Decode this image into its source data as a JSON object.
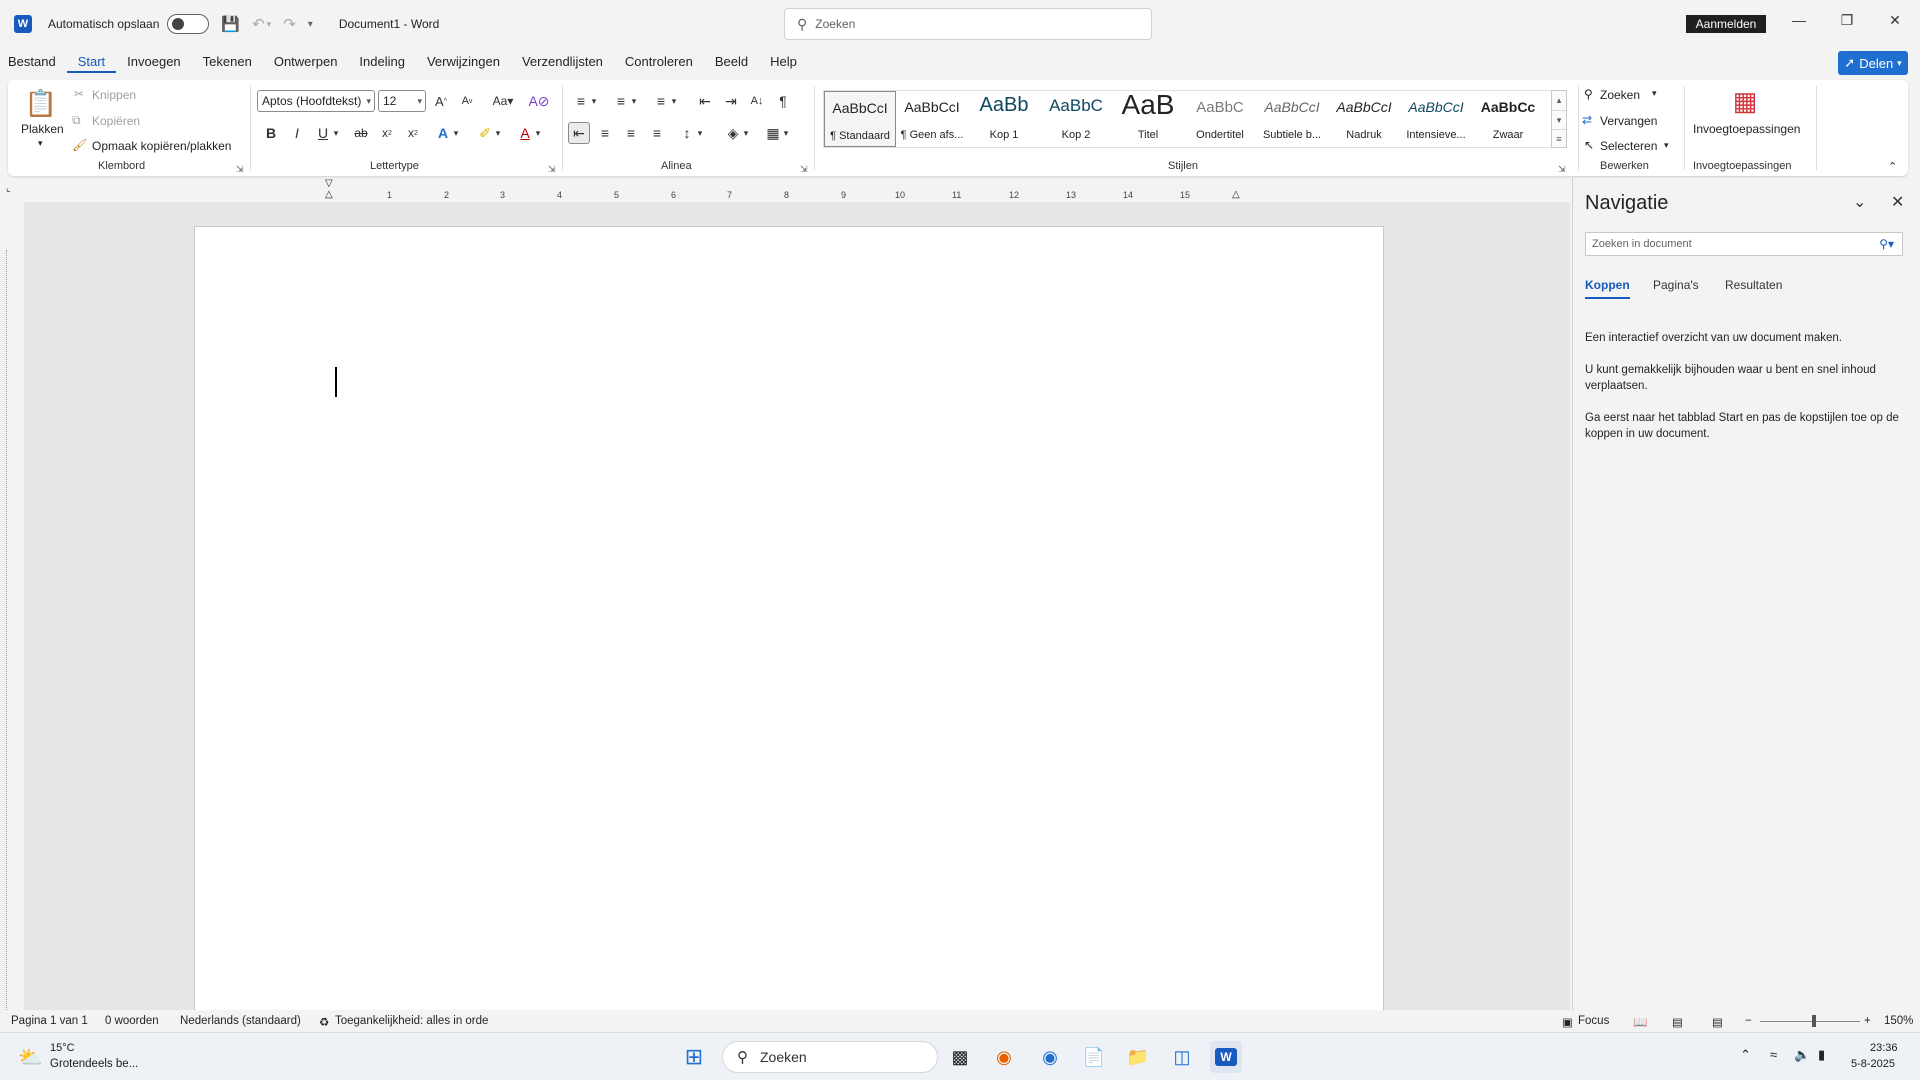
{
  "titlebar": {
    "autosave_label": "Automatisch opslaan",
    "doc_title": "Document1  -  Word",
    "search_placeholder": "Zoeken",
    "signin_label": "Aanmelden"
  },
  "menu": {
    "items": [
      "Bestand",
      "Start",
      "Invoegen",
      "Tekenen",
      "Ontwerpen",
      "Indeling",
      "Verwijzingen",
      "Verzendlijsten",
      "Controleren",
      "Beeld",
      "Help"
    ],
    "active": "Start",
    "share_label": "Delen"
  },
  "ribbon": {
    "clipboard": {
      "paste": "Plakken",
      "cut": "Knippen",
      "copy": "Kopiëren",
      "format_painter": "Opmaak kopiëren/plakken",
      "group": "Klembord"
    },
    "font": {
      "font_name": "Aptos (Hoofdtekst)",
      "font_size": "12",
      "group": "Lettertype"
    },
    "paragraph": {
      "group": "Alinea"
    },
    "styles": {
      "group": "Stijlen",
      "items": [
        {
          "sample": "AaBbCcI",
          "name": "¶ Standaard"
        },
        {
          "sample": "AaBbCcI",
          "name": "¶ Geen afs..."
        },
        {
          "sample": "AaBb",
          "name": "Kop 1"
        },
        {
          "sample": "AaBbC",
          "name": "Kop 2"
        },
        {
          "sample": "AaB",
          "name": "Titel"
        },
        {
          "sample": "AaBbC",
          "name": "Ondertitel"
        },
        {
          "sample": "AaBbCcI",
          "name": "Subtiele b..."
        },
        {
          "sample": "AaBbCcI",
          "name": "Nadruk"
        },
        {
          "sample": "AaBbCcI",
          "name": "Intensieve..."
        },
        {
          "sample": "AaBbCc",
          "name": "Zwaar"
        }
      ]
    },
    "editing": {
      "find": "Zoeken",
      "replace": "Vervangen",
      "select": "Selecteren",
      "group": "Bewerken"
    },
    "addins": {
      "button": "Invoegtoepassingen",
      "group": "Invoegtoepassingen"
    }
  },
  "ruler": {
    "numbers": [
      "1",
      "2",
      "3",
      "4",
      "5",
      "6",
      "7",
      "8",
      "9",
      "10",
      "11",
      "12",
      "13",
      "14",
      "15"
    ]
  },
  "navigation": {
    "title": "Navigatie",
    "search_placeholder": "Zoeken in document",
    "tabs": [
      "Koppen",
      "Pagina's",
      "Resultaten"
    ],
    "active_tab": "Koppen",
    "text1": "Een interactief overzicht van uw document maken.",
    "text2": "U kunt gemakkelijk bijhouden waar u bent en snel inhoud verplaatsen.",
    "text3": "Ga eerst naar het tabblad Start en pas de kopstijlen toe op de koppen in uw document."
  },
  "statusbar": {
    "page": "Pagina 1 van 1",
    "words": "0 woorden",
    "language": "Nederlands (standaard)",
    "accessibility": "Toegankelijkheid: alles in orde",
    "focus": "Focus",
    "zoom": "150%"
  },
  "taskbar": {
    "temperature": "15°C",
    "weather": "Grotendeels be...",
    "search_placeholder": "Zoeken",
    "time": "23:36",
    "date": "5-8-2025"
  },
  "colors": {
    "accent": "#185abd",
    "ribbon_bg": "#ffffff",
    "app_bg": "#f3f3f3"
  }
}
